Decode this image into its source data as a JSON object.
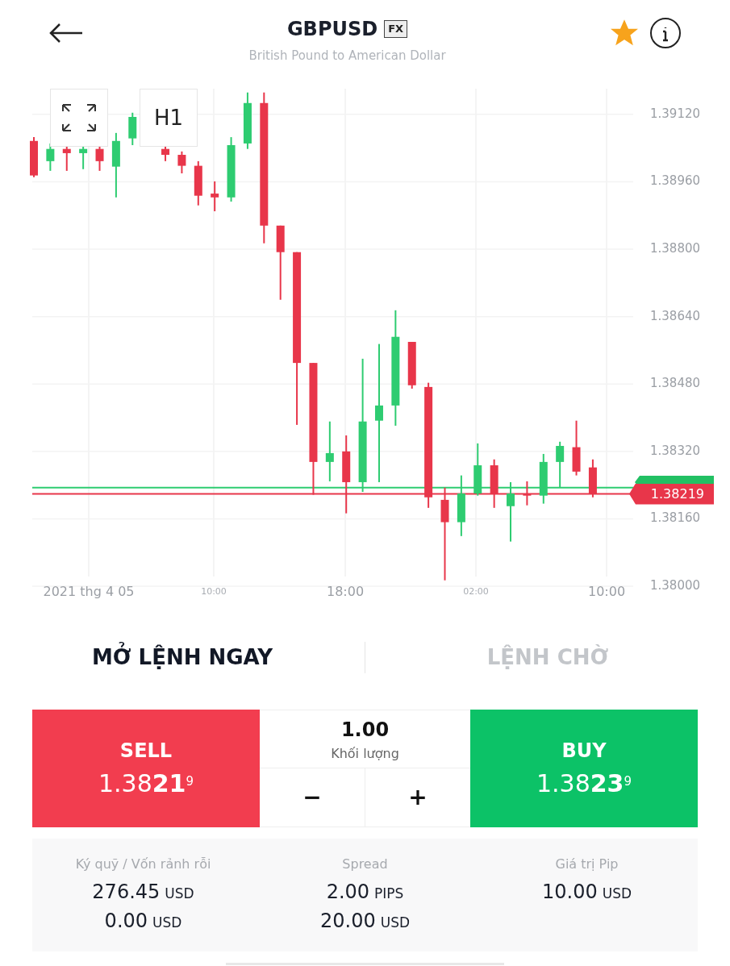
{
  "header": {
    "symbol": "GBPUSD",
    "badge": "FX",
    "subtitle": "British Pound to American Dollar",
    "favorite": true
  },
  "chart": {
    "timeframe": "H1",
    "x_labels": [
      {
        "text": "2021 thg 4 05",
        "minor": false
      },
      {
        "text": "10:00",
        "minor": true
      },
      {
        "text": "18:00",
        "minor": false
      },
      {
        "text": "02:00",
        "minor": true
      },
      {
        "text": "10:00",
        "minor": false
      }
    ],
    "chart_data": {
      "type": "candlestick",
      "ylim": [
        1.38,
        1.39181
      ],
      "grid": true,
      "ref_lines": [
        {
          "axis": "y",
          "value": 1.38234,
          "color": "#2ecc71"
        },
        {
          "axis": "y",
          "value": 1.38219,
          "color": "#e8364a",
          "label": "1.38219"
        }
      ],
      "yticks": [
        {
          "value": 1.3912,
          "label": "1.39120"
        },
        {
          "value": 1.3896,
          "label": "1.38960"
        },
        {
          "value": 1.388,
          "label": "1.38800"
        },
        {
          "value": 1.3864,
          "label": "1.38640"
        },
        {
          "value": 1.3848,
          "label": "1.38480"
        },
        {
          "value": 1.3832,
          "label": "1.38320"
        },
        {
          "value": 1.3816,
          "label": "1.38160"
        },
        {
          "value": 1.38,
          "label": "1.38000"
        }
      ],
      "ohlc": [
        [
          1.39057,
          1.39066,
          1.38971,
          1.38975
        ],
        [
          1.39009,
          1.39051,
          1.38986,
          1.39038
        ],
        [
          1.39038,
          1.39047,
          1.38986,
          1.39028
        ],
        [
          1.39028,
          1.39047,
          1.3899,
          1.39038
        ],
        [
          1.39038,
          1.39047,
          1.38986,
          1.39009
        ],
        [
          1.38996,
          1.39076,
          1.38923,
          1.39057
        ],
        [
          1.39063,
          1.39124,
          1.39047,
          1.39114
        ],
        null,
        [
          1.39038,
          1.39047,
          1.39009,
          1.39024
        ],
        [
          1.39024,
          1.39032,
          1.3898,
          1.38998
        ],
        [
          1.38998,
          1.39009,
          1.38904,
          1.38927
        ],
        [
          1.38932,
          1.38961,
          1.3889,
          1.38923
        ],
        [
          1.38923,
          1.39066,
          1.38913,
          1.39047
        ],
        [
          1.39051,
          1.39172,
          1.39038,
          1.39147
        ],
        [
          1.39147,
          1.39172,
          1.38814,
          1.38856
        ],
        [
          1.38856,
          1.38856,
          1.3868,
          1.38793
        ],
        [
          1.38793,
          1.38793,
          1.38383,
          1.3853
        ],
        [
          1.3853,
          1.3853,
          1.38217,
          1.38295
        ],
        [
          1.38295,
          1.38391,
          1.38249,
          1.38316
        ],
        [
          1.3832,
          1.38358,
          1.38173,
          1.38247
        ],
        [
          1.38247,
          1.3854,
          1.38224,
          1.38391
        ],
        [
          1.38393,
          1.38575,
          1.38247,
          1.38429
        ],
        [
          1.38429,
          1.38655,
          1.38381,
          1.38592
        ],
        [
          1.3858,
          1.3858,
          1.38469,
          1.38477
        ],
        [
          1.38473,
          1.38483,
          1.38186,
          1.38211
        ],
        [
          1.38205,
          1.38234,
          1.38014,
          1.38152
        ],
        [
          1.38152,
          1.38263,
          1.38119,
          1.3822
        ],
        [
          1.3822,
          1.38339,
          1.38215,
          1.38287
        ],
        [
          1.38287,
          1.38301,
          1.38186,
          1.3822
        ],
        [
          1.3819,
          1.38247,
          1.38106,
          1.3822
        ],
        [
          1.3822,
          1.38249,
          1.38192,
          1.38215
        ],
        [
          1.38215,
          1.38314,
          1.38196,
          1.38295
        ],
        [
          1.38295,
          1.38343,
          1.38234,
          1.38333
        ],
        [
          1.3833,
          1.38393,
          1.38263,
          1.38272
        ],
        [
          1.38282,
          1.38301,
          1.38211,
          1.3822
        ]
      ]
    }
  },
  "order_tabs": [
    {
      "label": "MỞ LỆNH NGAY",
      "selected": true
    },
    {
      "label": "LỆNH CHỜ",
      "selected": false
    }
  ],
  "sell": {
    "label": "SELL",
    "price": "1.38**21**$^{9}$"
  },
  "volume": {
    "value": "1.00",
    "label": "Khối lượng",
    "minus": "−",
    "plus": "+"
  },
  "buy": {
    "label": "BUY",
    "price": "1.38**23**$^{9}$"
  },
  "stats": [
    {
      "label": "Ký quỹ / Vốn rảnh rỗi",
      "lines": [
        {
          "value": "276.45",
          "unit": "USD"
        },
        {
          "value": "0.00",
          "unit": "USD"
        }
      ]
    },
    {
      "label": "Spread",
      "lines": [
        {
          "value": "2.00",
          "unit": "PIPS"
        },
        {
          "value": "20.00",
          "unit": "USD"
        }
      ]
    },
    {
      "label": "Giá trị Pip",
      "lines": [
        {
          "value": "10.00",
          "unit": "USD"
        }
      ]
    }
  ]
}
